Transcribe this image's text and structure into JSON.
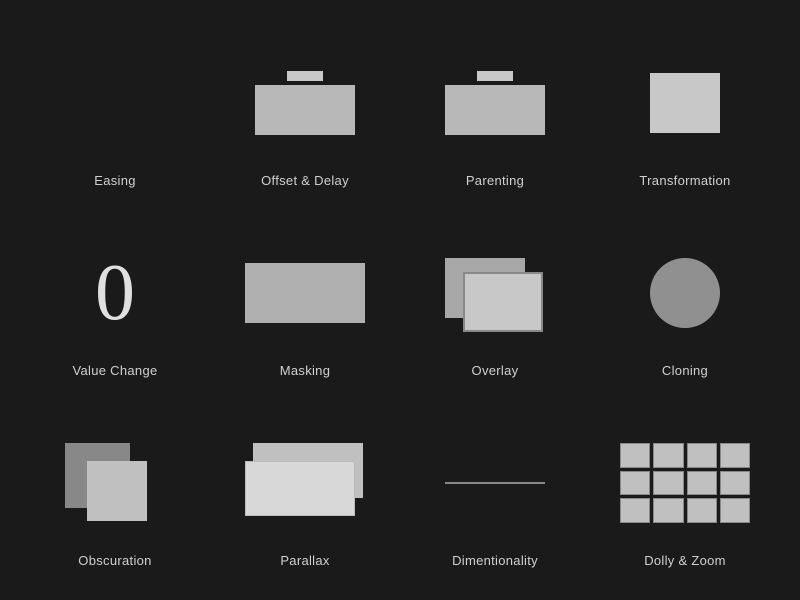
{
  "grid": {
    "cells": [
      {
        "id": "easing",
        "label": "Easing",
        "icon": "easing"
      },
      {
        "id": "offset-delay",
        "label": "Offset & Delay",
        "icon": "offset-delay"
      },
      {
        "id": "parenting",
        "label": "Parenting",
        "icon": "parenting"
      },
      {
        "id": "transformation",
        "label": "Transformation",
        "icon": "transformation"
      },
      {
        "id": "value-change",
        "label": "Value Change",
        "icon": "value-change"
      },
      {
        "id": "masking",
        "label": "Masking",
        "icon": "masking"
      },
      {
        "id": "overlay",
        "label": "Overlay",
        "icon": "overlay"
      },
      {
        "id": "cloning",
        "label": "Cloning",
        "icon": "cloning"
      },
      {
        "id": "obscuration",
        "label": "Obscuration",
        "icon": "obscuration"
      },
      {
        "id": "parallax",
        "label": "Parallax",
        "icon": "parallax"
      },
      {
        "id": "dimentionality",
        "label": "Dimentionality",
        "icon": "dimentionality"
      },
      {
        "id": "dolly-zoom",
        "label": "Dolly & Zoom",
        "icon": "dolly-zoom"
      }
    ]
  }
}
